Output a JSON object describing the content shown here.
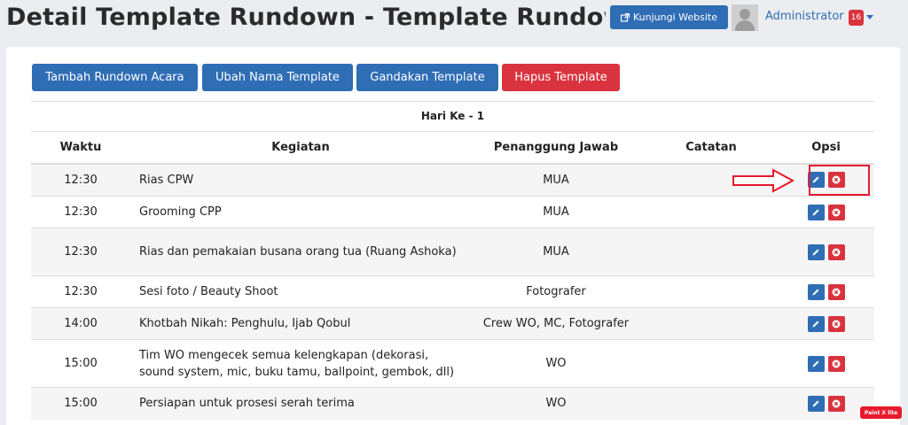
{
  "header": {
    "title": "Detail Template Rundown - Template Rundowr",
    "website_button": "Kunjungi Website",
    "user_name": "Administrator",
    "notification_count": "16"
  },
  "toolbar": {
    "add_event": "Tambah Rundown Acara",
    "rename_template": "Ubah Nama Template",
    "duplicate_template": "Gandakan Template",
    "delete_template": "Hapus Template"
  },
  "day_title": "Hari Ke - 1",
  "table": {
    "columns": {
      "time": "Waktu",
      "activity": "Kegiatan",
      "pic": "Penanggung Jawab",
      "notes": "Catatan",
      "options": "Opsi"
    },
    "rows": [
      {
        "time": "12:30",
        "activity": "Rias CPW",
        "pic": "MUA",
        "notes": ""
      },
      {
        "time": "12:30",
        "activity": "Grooming CPP",
        "pic": "MUA",
        "notes": ""
      },
      {
        "time": "12:30",
        "activity": "Rias dan pemakaian busana orang tua (Ruang Ashoka)",
        "pic": "MUA",
        "notes": ""
      },
      {
        "time": "12:30",
        "activity": "Sesi foto / Beauty Shoot",
        "pic": "Fotografer",
        "notes": ""
      },
      {
        "time": "14:00",
        "activity": "Khotbah Nikah: Penghulu, Ijab Qobul",
        "pic": "Crew WO, MC, Fotografer",
        "notes": ""
      },
      {
        "time": "15:00",
        "activity": "Tim WO mengecek semua kelengkapan (dekorasi, sound system, mic, buku tamu, ballpoint, gembok, dll)",
        "pic": "WO",
        "notes": ""
      },
      {
        "time": "15:00",
        "activity": "Persiapan untuk prosesi serah terima",
        "pic": "WO",
        "notes": ""
      }
    ]
  },
  "watermark": "Paint X lite",
  "colors": {
    "primary": "#2f6db5",
    "danger": "#d9333f",
    "annotation": "#e8192c"
  },
  "icons": {
    "website": "external-link-icon",
    "edit": "pencil-icon",
    "delete": "close-circle-icon",
    "user_menu": "chevron-down-icon"
  }
}
